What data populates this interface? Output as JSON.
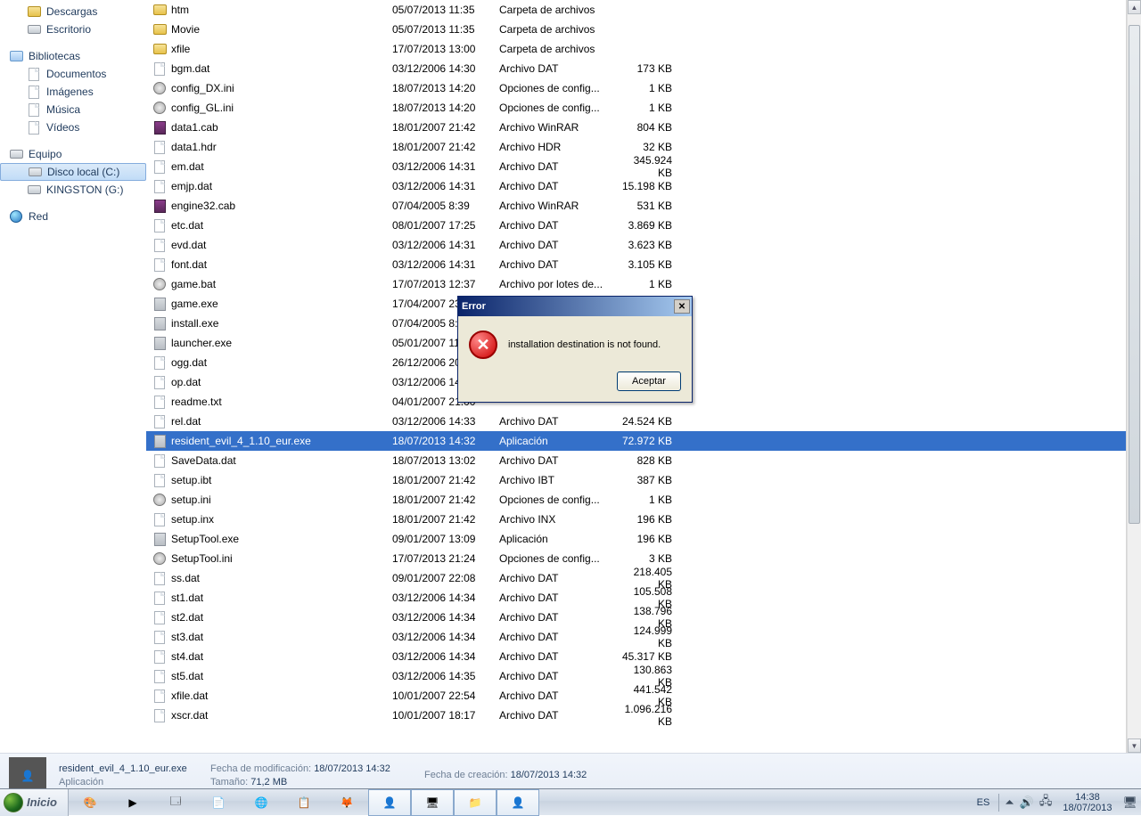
{
  "sidebar": {
    "groups": [
      {
        "items": [
          {
            "label": "Descargas",
            "icon": "folder"
          },
          {
            "label": "Escritorio",
            "icon": "desktop"
          }
        ]
      },
      {
        "header": "Bibliotecas",
        "icon": "lib",
        "items": [
          {
            "label": "Documentos",
            "icon": "doc"
          },
          {
            "label": "Imágenes",
            "icon": "img"
          },
          {
            "label": "Música",
            "icon": "music"
          },
          {
            "label": "Vídeos",
            "icon": "video"
          }
        ]
      },
      {
        "header": "Equipo",
        "icon": "computer",
        "items": [
          {
            "label": "Disco local (C:)",
            "icon": "drive",
            "selected": true
          },
          {
            "label": "KINGSTON (G:)",
            "icon": "drive"
          }
        ]
      },
      {
        "header": "Red",
        "icon": "net",
        "items": []
      }
    ]
  },
  "files": [
    {
      "name": "htm",
      "date": "05/07/2013 11:35",
      "type": "Carpeta de archivos",
      "size": "",
      "icon": "folder"
    },
    {
      "name": "Movie",
      "date": "05/07/2013 11:35",
      "type": "Carpeta de archivos",
      "size": "",
      "icon": "folder"
    },
    {
      "name": "xfile",
      "date": "17/07/2013 13:00",
      "type": "Carpeta de archivos",
      "size": "",
      "icon": "folder"
    },
    {
      "name": "bgm.dat",
      "date": "03/12/2006 14:30",
      "type": "Archivo DAT",
      "size": "173 KB",
      "icon": "file"
    },
    {
      "name": "config_DX.ini",
      "date": "18/07/2013 14:20",
      "type": "Opciones de config...",
      "size": "1 KB",
      "icon": "cog"
    },
    {
      "name": "config_GL.ini",
      "date": "18/07/2013 14:20",
      "type": "Opciones de config...",
      "size": "1 KB",
      "icon": "cog"
    },
    {
      "name": "data1.cab",
      "date": "18/01/2007 21:42",
      "type": "Archivo WinRAR",
      "size": "804 KB",
      "icon": "rar"
    },
    {
      "name": "data1.hdr",
      "date": "18/01/2007 21:42",
      "type": "Archivo HDR",
      "size": "32 KB",
      "icon": "file"
    },
    {
      "name": "em.dat",
      "date": "03/12/2006 14:31",
      "type": "Archivo DAT",
      "size": "345.924 KB",
      "icon": "file"
    },
    {
      "name": "emjp.dat",
      "date": "03/12/2006 14:31",
      "type": "Archivo DAT",
      "size": "15.198 KB",
      "icon": "file"
    },
    {
      "name": "engine32.cab",
      "date": "07/04/2005 8:39",
      "type": "Archivo WinRAR",
      "size": "531 KB",
      "icon": "rar"
    },
    {
      "name": "etc.dat",
      "date": "08/01/2007 17:25",
      "type": "Archivo DAT",
      "size": "3.869 KB",
      "icon": "file"
    },
    {
      "name": "evd.dat",
      "date": "03/12/2006 14:31",
      "type": "Archivo DAT",
      "size": "3.623 KB",
      "icon": "file"
    },
    {
      "name": "font.dat",
      "date": "03/12/2006 14:31",
      "type": "Archivo DAT",
      "size": "3.105 KB",
      "icon": "file"
    },
    {
      "name": "game.bat",
      "date": "17/07/2013 12:37",
      "type": "Archivo por lotes de...",
      "size": "1 KB",
      "icon": "cog"
    },
    {
      "name": "game.exe",
      "date": "17/04/2007 23:51",
      "type": "",
      "size": "",
      "icon": "exe"
    },
    {
      "name": "install.exe",
      "date": "07/04/2005 8:39",
      "type": "",
      "size": "",
      "icon": "exe"
    },
    {
      "name": "launcher.exe",
      "date": "05/01/2007 11:23",
      "type": "",
      "size": "",
      "icon": "exe"
    },
    {
      "name": "ogg.dat",
      "date": "26/12/2006 20:23",
      "type": "",
      "size": "",
      "icon": "file"
    },
    {
      "name": "op.dat",
      "date": "03/12/2006 14:31",
      "type": "",
      "size": "",
      "icon": "file"
    },
    {
      "name": "readme.txt",
      "date": "04/01/2007 21:00",
      "type": "",
      "size": "",
      "icon": "file"
    },
    {
      "name": "rel.dat",
      "date": "03/12/2006 14:33",
      "type": "Archivo DAT",
      "size": "24.524 KB",
      "icon": "file"
    },
    {
      "name": "resident_evil_4_1.10_eur.exe",
      "date": "18/07/2013 14:32",
      "type": "Aplicación",
      "size": "72.972 KB",
      "icon": "exe",
      "selected": true
    },
    {
      "name": "SaveData.dat",
      "date": "18/07/2013 13:02",
      "type": "Archivo DAT",
      "size": "828 KB",
      "icon": "file"
    },
    {
      "name": "setup.ibt",
      "date": "18/01/2007 21:42",
      "type": "Archivo IBT",
      "size": "387 KB",
      "icon": "file"
    },
    {
      "name": "setup.ini",
      "date": "18/01/2007 21:42",
      "type": "Opciones de config...",
      "size": "1 KB",
      "icon": "cog"
    },
    {
      "name": "setup.inx",
      "date": "18/01/2007 21:42",
      "type": "Archivo INX",
      "size": "196 KB",
      "icon": "file"
    },
    {
      "name": "SetupTool.exe",
      "date": "09/01/2007 13:09",
      "type": "Aplicación",
      "size": "196 KB",
      "icon": "exe"
    },
    {
      "name": "SetupTool.ini",
      "date": "17/07/2013 21:24",
      "type": "Opciones de config...",
      "size": "3 KB",
      "icon": "cog"
    },
    {
      "name": "ss.dat",
      "date": "09/01/2007 22:08",
      "type": "Archivo DAT",
      "size": "218.405 KB",
      "icon": "file"
    },
    {
      "name": "st1.dat",
      "date": "03/12/2006 14:34",
      "type": "Archivo DAT",
      "size": "105.508 KB",
      "icon": "file"
    },
    {
      "name": "st2.dat",
      "date": "03/12/2006 14:34",
      "type": "Archivo DAT",
      "size": "138.796 KB",
      "icon": "file"
    },
    {
      "name": "st3.dat",
      "date": "03/12/2006 14:34",
      "type": "Archivo DAT",
      "size": "124.999 KB",
      "icon": "file"
    },
    {
      "name": "st4.dat",
      "date": "03/12/2006 14:34",
      "type": "Archivo DAT",
      "size": "45.317 KB",
      "icon": "file"
    },
    {
      "name": "st5.dat",
      "date": "03/12/2006 14:35",
      "type": "Archivo DAT",
      "size": "130.863 KB",
      "icon": "file"
    },
    {
      "name": "xfile.dat",
      "date": "10/01/2007 22:54",
      "type": "Archivo DAT",
      "size": "441.542 KB",
      "icon": "file"
    },
    {
      "name": "xscr.dat",
      "date": "10/01/2007 18:17",
      "type": "Archivo DAT",
      "size": "1.096.216 KB",
      "icon": "file"
    }
  ],
  "details": {
    "filename": "resident_evil_4_1.10_eur.exe",
    "mod_label": "Fecha de modificación:",
    "mod_value": "18/07/2013 14:32",
    "type": "Aplicación",
    "size_label": "Tamaño:",
    "size_value": "71,2 MB",
    "create_label": "Fecha de creación:",
    "create_value": "18/07/2013 14:32"
  },
  "dialog": {
    "title": "Error",
    "message": "installation destination is not found.",
    "ok": "Aceptar"
  },
  "taskbar": {
    "start": "Inicio",
    "lang": "ES",
    "time": "14:38",
    "date": "18/07/2013"
  }
}
